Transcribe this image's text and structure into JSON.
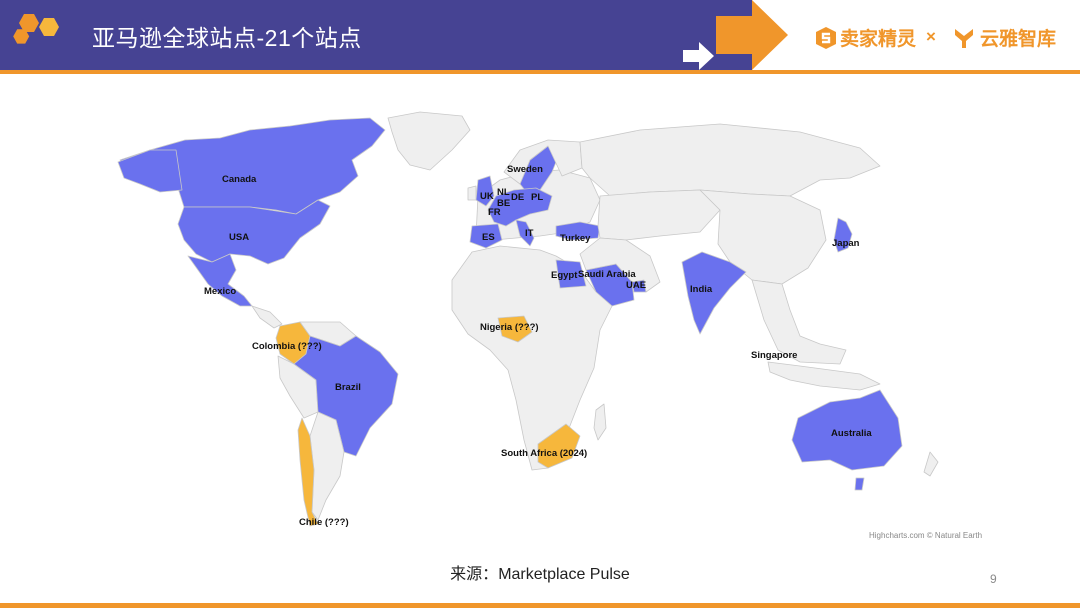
{
  "header": {
    "title": "亚马逊全球站点-21个站点",
    "brand_left": "卖家精灵",
    "brand_sep": "×",
    "brand_right": "云雅智库"
  },
  "colors": {
    "header_band": "#464393",
    "accent": "#f0962b",
    "site_existing": "#6a71ee",
    "site_planned": "#f6b73c",
    "land": "#efefef",
    "border": "#c8c8c8"
  },
  "map": {
    "legend_note": "",
    "sites": [
      {
        "name": "Canada",
        "status": "existing"
      },
      {
        "name": "USA",
        "status": "existing"
      },
      {
        "name": "Mexico",
        "status": "existing"
      },
      {
        "name": "Brazil",
        "status": "existing"
      },
      {
        "name": "Colombia (???)",
        "status": "planned"
      },
      {
        "name": "Chile (???)",
        "status": "planned"
      },
      {
        "name": "Sweden",
        "status": "existing"
      },
      {
        "name": "UK",
        "status": "existing"
      },
      {
        "name": "NL",
        "status": "existing"
      },
      {
        "name": "BE",
        "status": "existing"
      },
      {
        "name": "DE",
        "status": "existing"
      },
      {
        "name": "PL",
        "status": "existing"
      },
      {
        "name": "FR",
        "status": "existing"
      },
      {
        "name": "ES",
        "status": "existing"
      },
      {
        "name": "IT",
        "status": "existing"
      },
      {
        "name": "Turkey",
        "status": "existing"
      },
      {
        "name": "Egypt",
        "status": "existing"
      },
      {
        "name": "Saudi Arabia",
        "status": "existing"
      },
      {
        "name": "UAE",
        "status": "existing"
      },
      {
        "name": "India",
        "status": "existing"
      },
      {
        "name": "Japan",
        "status": "existing"
      },
      {
        "name": "Singapore",
        "status": "existing"
      },
      {
        "name": "Australia",
        "status": "existing"
      },
      {
        "name": "Nigeria (???)",
        "status": "planned"
      },
      {
        "name": "South Africa (2024)",
        "status": "planned"
      }
    ],
    "credit": "Highcharts.com © Natural Earth"
  },
  "footer": {
    "source_label": "来源：",
    "source_value": "Marketplace Pulse",
    "page_number": "9"
  }
}
